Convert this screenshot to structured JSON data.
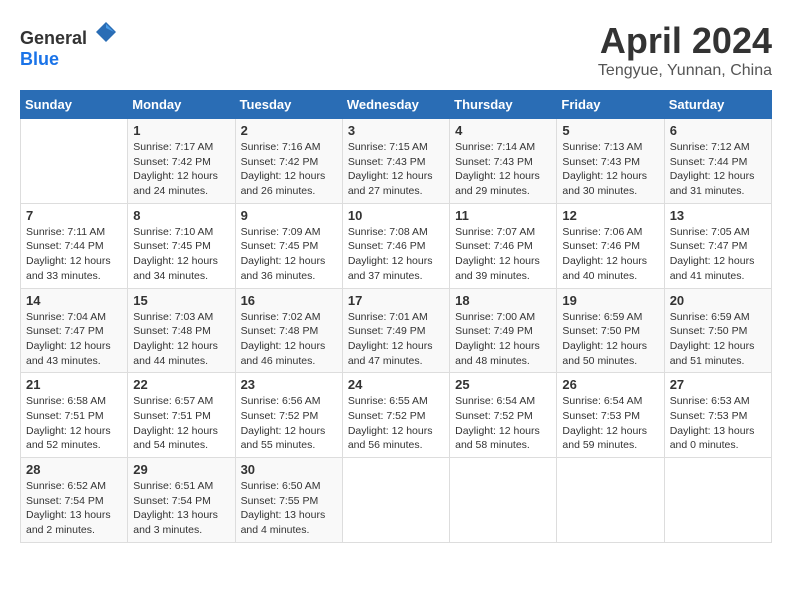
{
  "header": {
    "logo_general": "General",
    "logo_blue": "Blue",
    "month_title": "April 2024",
    "location": "Tengyue, Yunnan, China"
  },
  "weekdays": [
    "Sunday",
    "Monday",
    "Tuesday",
    "Wednesday",
    "Thursday",
    "Friday",
    "Saturday"
  ],
  "weeks": [
    [
      {
        "day": "",
        "sunrise": "",
        "sunset": "",
        "daylight": ""
      },
      {
        "day": "1",
        "sunrise": "Sunrise: 7:17 AM",
        "sunset": "Sunset: 7:42 PM",
        "daylight": "Daylight: 12 hours and 24 minutes."
      },
      {
        "day": "2",
        "sunrise": "Sunrise: 7:16 AM",
        "sunset": "Sunset: 7:42 PM",
        "daylight": "Daylight: 12 hours and 26 minutes."
      },
      {
        "day": "3",
        "sunrise": "Sunrise: 7:15 AM",
        "sunset": "Sunset: 7:43 PM",
        "daylight": "Daylight: 12 hours and 27 minutes."
      },
      {
        "day": "4",
        "sunrise": "Sunrise: 7:14 AM",
        "sunset": "Sunset: 7:43 PM",
        "daylight": "Daylight: 12 hours and 29 minutes."
      },
      {
        "day": "5",
        "sunrise": "Sunrise: 7:13 AM",
        "sunset": "Sunset: 7:43 PM",
        "daylight": "Daylight: 12 hours and 30 minutes."
      },
      {
        "day": "6",
        "sunrise": "Sunrise: 7:12 AM",
        "sunset": "Sunset: 7:44 PM",
        "daylight": "Daylight: 12 hours and 31 minutes."
      }
    ],
    [
      {
        "day": "7",
        "sunrise": "Sunrise: 7:11 AM",
        "sunset": "Sunset: 7:44 PM",
        "daylight": "Daylight: 12 hours and 33 minutes."
      },
      {
        "day": "8",
        "sunrise": "Sunrise: 7:10 AM",
        "sunset": "Sunset: 7:45 PM",
        "daylight": "Daylight: 12 hours and 34 minutes."
      },
      {
        "day": "9",
        "sunrise": "Sunrise: 7:09 AM",
        "sunset": "Sunset: 7:45 PM",
        "daylight": "Daylight: 12 hours and 36 minutes."
      },
      {
        "day": "10",
        "sunrise": "Sunrise: 7:08 AM",
        "sunset": "Sunset: 7:46 PM",
        "daylight": "Daylight: 12 hours and 37 minutes."
      },
      {
        "day": "11",
        "sunrise": "Sunrise: 7:07 AM",
        "sunset": "Sunset: 7:46 PM",
        "daylight": "Daylight: 12 hours and 39 minutes."
      },
      {
        "day": "12",
        "sunrise": "Sunrise: 7:06 AM",
        "sunset": "Sunset: 7:46 PM",
        "daylight": "Daylight: 12 hours and 40 minutes."
      },
      {
        "day": "13",
        "sunrise": "Sunrise: 7:05 AM",
        "sunset": "Sunset: 7:47 PM",
        "daylight": "Daylight: 12 hours and 41 minutes."
      }
    ],
    [
      {
        "day": "14",
        "sunrise": "Sunrise: 7:04 AM",
        "sunset": "Sunset: 7:47 PM",
        "daylight": "Daylight: 12 hours and 43 minutes."
      },
      {
        "day": "15",
        "sunrise": "Sunrise: 7:03 AM",
        "sunset": "Sunset: 7:48 PM",
        "daylight": "Daylight: 12 hours and 44 minutes."
      },
      {
        "day": "16",
        "sunrise": "Sunrise: 7:02 AM",
        "sunset": "Sunset: 7:48 PM",
        "daylight": "Daylight: 12 hours and 46 minutes."
      },
      {
        "day": "17",
        "sunrise": "Sunrise: 7:01 AM",
        "sunset": "Sunset: 7:49 PM",
        "daylight": "Daylight: 12 hours and 47 minutes."
      },
      {
        "day": "18",
        "sunrise": "Sunrise: 7:00 AM",
        "sunset": "Sunset: 7:49 PM",
        "daylight": "Daylight: 12 hours and 48 minutes."
      },
      {
        "day": "19",
        "sunrise": "Sunrise: 6:59 AM",
        "sunset": "Sunset: 7:50 PM",
        "daylight": "Daylight: 12 hours and 50 minutes."
      },
      {
        "day": "20",
        "sunrise": "Sunrise: 6:59 AM",
        "sunset": "Sunset: 7:50 PM",
        "daylight": "Daylight: 12 hours and 51 minutes."
      }
    ],
    [
      {
        "day": "21",
        "sunrise": "Sunrise: 6:58 AM",
        "sunset": "Sunset: 7:51 PM",
        "daylight": "Daylight: 12 hours and 52 minutes."
      },
      {
        "day": "22",
        "sunrise": "Sunrise: 6:57 AM",
        "sunset": "Sunset: 7:51 PM",
        "daylight": "Daylight: 12 hours and 54 minutes."
      },
      {
        "day": "23",
        "sunrise": "Sunrise: 6:56 AM",
        "sunset": "Sunset: 7:52 PM",
        "daylight": "Daylight: 12 hours and 55 minutes."
      },
      {
        "day": "24",
        "sunrise": "Sunrise: 6:55 AM",
        "sunset": "Sunset: 7:52 PM",
        "daylight": "Daylight: 12 hours and 56 minutes."
      },
      {
        "day": "25",
        "sunrise": "Sunrise: 6:54 AM",
        "sunset": "Sunset: 7:52 PM",
        "daylight": "Daylight: 12 hours and 58 minutes."
      },
      {
        "day": "26",
        "sunrise": "Sunrise: 6:54 AM",
        "sunset": "Sunset: 7:53 PM",
        "daylight": "Daylight: 12 hours and 59 minutes."
      },
      {
        "day": "27",
        "sunrise": "Sunrise: 6:53 AM",
        "sunset": "Sunset: 7:53 PM",
        "daylight": "Daylight: 13 hours and 0 minutes."
      }
    ],
    [
      {
        "day": "28",
        "sunrise": "Sunrise: 6:52 AM",
        "sunset": "Sunset: 7:54 PM",
        "daylight": "Daylight: 13 hours and 2 minutes."
      },
      {
        "day": "29",
        "sunrise": "Sunrise: 6:51 AM",
        "sunset": "Sunset: 7:54 PM",
        "daylight": "Daylight: 13 hours and 3 minutes."
      },
      {
        "day": "30",
        "sunrise": "Sunrise: 6:50 AM",
        "sunset": "Sunset: 7:55 PM",
        "daylight": "Daylight: 13 hours and 4 minutes."
      },
      {
        "day": "",
        "sunrise": "",
        "sunset": "",
        "daylight": ""
      },
      {
        "day": "",
        "sunrise": "",
        "sunset": "",
        "daylight": ""
      },
      {
        "day": "",
        "sunrise": "",
        "sunset": "",
        "daylight": ""
      },
      {
        "day": "",
        "sunrise": "",
        "sunset": "",
        "daylight": ""
      }
    ]
  ]
}
